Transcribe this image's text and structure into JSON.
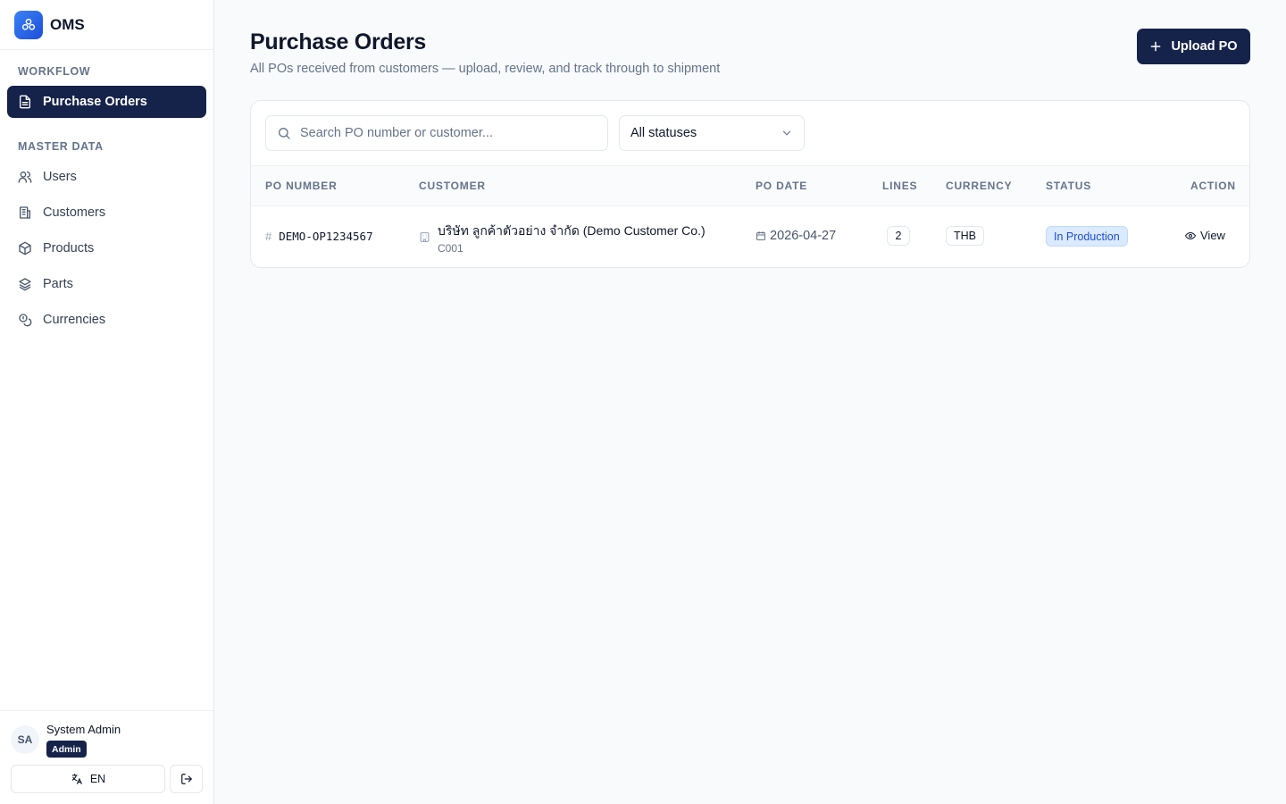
{
  "app": {
    "name": "OMS"
  },
  "sidebar": {
    "workflow_label": "WORKFLOW",
    "active_item": {
      "label": "Purchase Orders",
      "icon": "document-icon"
    },
    "master_label": "MASTER DATA",
    "items": [
      {
        "label": "Users",
        "icon": "users-icon"
      },
      {
        "label": "Customers",
        "icon": "building-icon"
      },
      {
        "label": "Products",
        "icon": "box-icon"
      },
      {
        "label": "Parts",
        "icon": "layers-icon"
      },
      {
        "label": "Currencies",
        "icon": "coins-icon"
      }
    ],
    "user": {
      "initials": "SA",
      "name": "System Admin",
      "role": "Admin"
    },
    "language": "EN"
  },
  "header": {
    "title": "Purchase Orders",
    "subtitle": "All POs received from customers — upload, review, and track through to shipment",
    "upload_label": "Upload PO"
  },
  "filters": {
    "search_placeholder": "Search PO number or customer...",
    "status_value": "All statuses"
  },
  "table": {
    "columns": [
      "PO NUMBER",
      "CUSTOMER",
      "PO DATE",
      "LINES",
      "CURRENCY",
      "STATUS",
      "ACTION"
    ],
    "rows": [
      {
        "po_number": "DEMO-OP1234567",
        "customer_name": "บริษัท ลูกค้าตัวอย่าง จำกัด (Demo Customer Co.)",
        "customer_code": "C001",
        "po_date": "2026-04-27",
        "lines": "2",
        "currency": "THB",
        "status": "In Production",
        "action": "View"
      }
    ]
  },
  "colors": {
    "primary": "#15224a",
    "status_bg": "#dbeafe",
    "status_text": "#1d4ed8",
    "muted_text": "#64748b"
  }
}
